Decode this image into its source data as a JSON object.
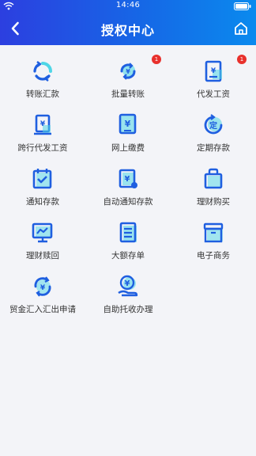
{
  "status_bar": {
    "time": "14:46"
  },
  "header": {
    "title": "授权中心"
  },
  "colors": {
    "brand_start": "#2c3fe0",
    "brand_end": "#0a8aee",
    "icon_blue": "#1f5fe0",
    "icon_accent": "#4fd6e6",
    "badge": "#e8302c"
  },
  "items": [
    {
      "label": "转账汇款",
      "icon": "cycle-arrows-icon",
      "badge": ""
    },
    {
      "label": "批量转账",
      "icon": "batch-transfer-icon",
      "badge": "1"
    },
    {
      "label": "代发工资",
      "icon": "salary-document-icon",
      "badge": "1"
    },
    {
      "label": "跨行代发工资",
      "icon": "interbank-salary-icon",
      "badge": ""
    },
    {
      "label": "网上缴费",
      "icon": "online-payment-icon",
      "badge": ""
    },
    {
      "label": "定期存款",
      "icon": "fixed-deposit-icon",
      "badge": ""
    },
    {
      "label": "通知存款",
      "icon": "calendar-check-icon",
      "badge": ""
    },
    {
      "label": "自动通知存款",
      "icon": "auto-notice-deposit-icon",
      "badge": ""
    },
    {
      "label": "理财购买",
      "icon": "shopping-bag-icon",
      "badge": ""
    },
    {
      "label": "理财赎回",
      "icon": "monitor-chart-icon",
      "badge": ""
    },
    {
      "label": "大额存单",
      "icon": "large-deposit-icon",
      "badge": ""
    },
    {
      "label": "电子商务",
      "icon": "archive-box-icon",
      "badge": ""
    },
    {
      "label": "贸金汇入汇出申请",
      "icon": "currency-exchange-icon",
      "badge": ""
    },
    {
      "label": "自助托收办理",
      "icon": "self-collection-icon",
      "badge": ""
    }
  ]
}
